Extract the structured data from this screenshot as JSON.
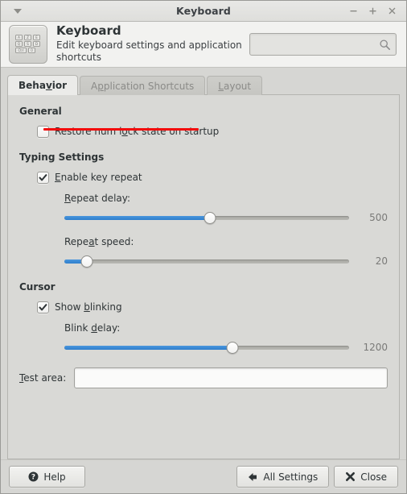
{
  "window": {
    "title": "Keyboard",
    "menu_icon": "chevron-down-icon",
    "controls": [
      {
        "name": "minimize",
        "glyph": "–"
      },
      {
        "name": "maximize",
        "glyph": "+"
      },
      {
        "name": "close",
        "glyph": "×"
      }
    ]
  },
  "header": {
    "icon": "keyboard-icon",
    "title": "Keyboard",
    "subtitle": "Edit keyboard settings and application shortcuts",
    "search": {
      "value": "",
      "placeholder": "",
      "icon": "search-icon"
    }
  },
  "tabs": [
    {
      "label": "Behavior",
      "mnemonic_index": 4,
      "active": true
    },
    {
      "label": "Application Shortcuts",
      "mnemonic_index": 1,
      "active": false
    },
    {
      "label": "Layout",
      "mnemonic_index": 0,
      "active": false
    }
  ],
  "behavior": {
    "general": {
      "title": "General",
      "restore_numlock": {
        "label": "Restore num lock state on startup",
        "mnemonic_index": 16,
        "checked": false
      }
    },
    "typing": {
      "title": "Typing Settings",
      "enable_key_repeat": {
        "label": "Enable key repeat",
        "mnemonic_index": 0,
        "checked": true
      },
      "repeat_delay": {
        "label": "Repeat delay:",
        "mnemonic_index": 0,
        "value": "500",
        "percent": 51
      },
      "repeat_speed": {
        "label": "Repeat speed:",
        "mnemonic_index": 4,
        "value": "20",
        "percent": 8
      }
    },
    "cursor": {
      "title": "Cursor",
      "show_blinking": {
        "label": "Show blinking",
        "mnemonic_index": 5,
        "checked": true
      },
      "blink_delay": {
        "label": "Blink delay:",
        "mnemonic_index": 6,
        "value": "1200",
        "percent": 59
      }
    },
    "test_area": {
      "label": "Test area:",
      "mnemonic_index": 0,
      "value": "",
      "placeholder": ""
    }
  },
  "actions": {
    "help": {
      "label": "Help",
      "icon": "help-circle-icon"
    },
    "all_settings": {
      "label": "All Settings",
      "icon": "back-arrow-icon"
    },
    "close": {
      "label": "Close",
      "icon": "close-cross-icon"
    }
  },
  "annotation": {
    "color": "#f20d0d",
    "target": "Restore num lock state on startup"
  }
}
